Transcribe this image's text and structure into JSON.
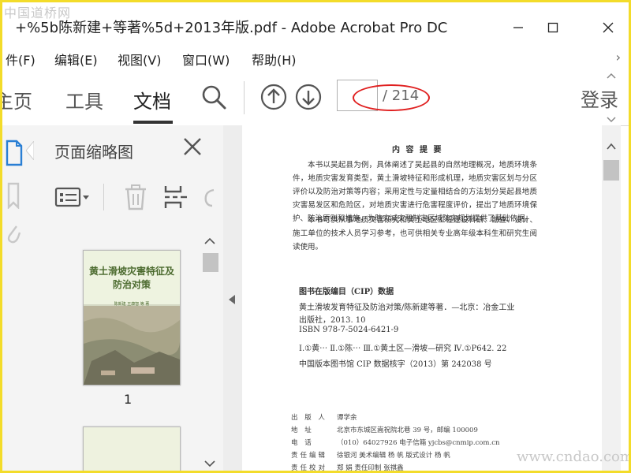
{
  "window": {
    "title": "+%5b陈新建+等著%5d+2013年版.pdf - Adobe Acrobat Pro DC",
    "watermark_top": "中国道桥网",
    "watermark_bottom": "www.cndao.com"
  },
  "menu": {
    "items": [
      "件(F)",
      "编辑(E)",
      "视图(V)",
      "窗口(W)",
      "帮助(H)"
    ],
    "more": "›"
  },
  "toolbar": {
    "tabs": [
      "主页",
      "工具",
      "文档"
    ],
    "active_tab": "文档",
    "page_current": "",
    "page_total": "/ 214",
    "login": "登录"
  },
  "thumb_panel": {
    "title": "页面缩略图",
    "page1_label": "1",
    "book_title": "黄土滑坡灾害特征及防治对策",
    "book_authors": "陈新建 王康智 等 著"
  },
  "document": {
    "summary_title": "内 容 提 要",
    "summary_p1": "本书以吴起县为例，具体阐述了吴起县的自然地理概况，地质环境条件，地质灾害发育类型，黄土滑坡特征和形成机理，地质灾害区划与分区评价以及防治对策等内容；采用定性与定量相结合的方法划分吴起县地质灾害易发区和危险区，对地质灾害进行危害程度评价，提出了地质环境保护、防治原则和措施，为防灾减灾和制定区域防灾规划提供了基础依据。",
    "summary_p2": "本书可供从事地质灾害研究和黄土地区工程建设科研、勘查、设计、施工单位的技术人员学习参考，也可供相关专业高年级本科生和研究生阅读使用。",
    "cip_head": "图书在版编目（CIP）数据",
    "cip_lines": [
      "黄土滑坡发育特征及防治对策/陈新建等著．—北京：冶金工业",
      "出版社，2013. 10",
      "ISBN 978-7-5024-6421-9",
      "Ⅰ.①黄⋯  Ⅱ.①陈⋯  Ⅲ.①黄土区—滑坡—研究  Ⅳ.①P642. 22",
      "中国版本图书馆 CIP 数据核字（2013）第 242038 号"
    ],
    "pub_rows": [
      {
        "k": "出 版 人",
        "v": "谭学余"
      },
      {
        "k": "地  址",
        "v": "北京市东城区嵩祝院北巷 39 号，邮编 100009"
      },
      {
        "k": "电  话",
        "v": "（010）64027926  电子信箱  yjcbs@cnmip.com.cn"
      },
      {
        "k": "责任编辑",
        "v": "徐银河  美术编辑  杨 帆  版式设计  杨 帆"
      },
      {
        "k": "责任校对",
        "v": "郑 娟  责任印制  张祺鑫"
      }
    ]
  },
  "colors": {
    "frame": "#f3dc2a",
    "annotation_ellipse": "#e02020",
    "panel_bg": "#f4f4f4",
    "icon_blue": "#2a7fd4"
  }
}
